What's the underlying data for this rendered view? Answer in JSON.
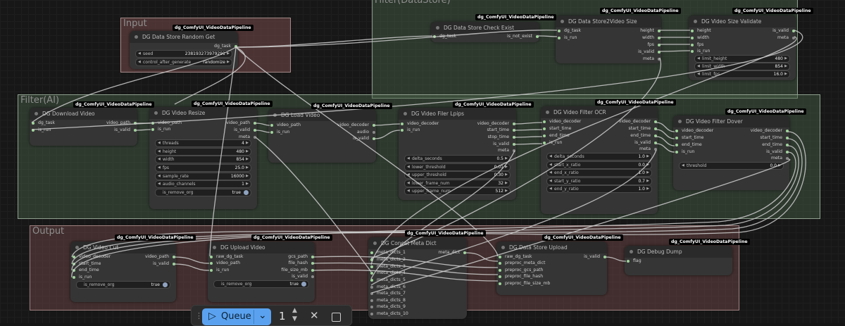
{
  "badge": "dg_ComfyUI_VideoDataPipeline",
  "groups": {
    "input": "Input",
    "ai": "Filter(AI)",
    "ds": "Filter(DataStore)",
    "out": "Output"
  },
  "nodes": {
    "random_get": {
      "title": "DG Data Store Random Get",
      "out_dg_task": "dg_task",
      "w_seed": {
        "label": "seed",
        "value": "238193273979291"
      },
      "w_ctrl": {
        "label": "control_after_generate",
        "value": "randomize"
      }
    },
    "check_exist": {
      "title": "DG Data Store Check Exist",
      "in_dg_task": "dg_task",
      "out_is_not_exist": "is_not_exist"
    },
    "ds2vs": {
      "title": "DG Data Store2Video Size",
      "in": [
        "dg_task",
        "is_run"
      ],
      "out": [
        "height",
        "width",
        "fps",
        "is_valid",
        "meta"
      ]
    },
    "vsv": {
      "title": "DG Video Size Validate",
      "in": [
        "height",
        "width",
        "fps",
        "is_run"
      ],
      "out": [
        "is_valid",
        "meta"
      ],
      "widgets": [
        {
          "label": "limit_height",
          "value": "480"
        },
        {
          "label": "limit_width",
          "value": "854"
        },
        {
          "label": "limit_fps",
          "value": "16.0"
        }
      ]
    },
    "download": {
      "title": "DG Download Video",
      "in": [
        "dg_task",
        "is_run"
      ],
      "out": [
        "video_path",
        "is_valid"
      ]
    },
    "resize": {
      "title": "DG Video Resize",
      "in": [
        "video_path",
        "is_run"
      ],
      "out": [
        "video_path",
        "is_valid",
        "meta"
      ],
      "widgets": [
        {
          "label": "threads",
          "value": "4"
        },
        {
          "label": "height",
          "value": "480"
        },
        {
          "label": "width",
          "value": "854"
        },
        {
          "label": "fps",
          "value": "25.0"
        },
        {
          "label": "sample_rate",
          "value": "16000"
        },
        {
          "label": "audio_channels",
          "value": "1"
        }
      ],
      "toggle": {
        "label": "is_remove_org",
        "value": "true"
      }
    },
    "load": {
      "title": "DG Load Video",
      "in": [
        "video_path",
        "is_run"
      ],
      "out": [
        "video_decoder",
        "audio",
        "is_valid"
      ]
    },
    "lpips": {
      "title": "DG Video Filer Lpips",
      "in": [
        "video_decoder",
        "is_run"
      ],
      "out": [
        "video_decoder",
        "start_time",
        "stop_time",
        "is_valid",
        "meta"
      ],
      "widgets": [
        {
          "label": "delta_seconds",
          "value": "0.5"
        },
        {
          "label": "lower_threshold",
          "value": "0.01"
        },
        {
          "label": "upper_threshold",
          "value": "0.30"
        },
        {
          "label": "lower_frame_num",
          "value": "32"
        },
        {
          "label": "upper_frame_num",
          "value": "512"
        }
      ]
    },
    "ocr": {
      "title": "DG Video Filter OCR",
      "in": [
        "video_decoder",
        "start_time",
        "end_time",
        "is_run"
      ],
      "out": [
        "video_decoder",
        "start_time",
        "end_time",
        "is_valid",
        "meta"
      ],
      "widgets": [
        {
          "label": "delta_seconds",
          "value": "1.0"
        },
        {
          "label": "start_x_ratio",
          "value": "0.0"
        },
        {
          "label": "end_x_ratio",
          "value": "1.0"
        },
        {
          "label": "start_y_ratio",
          "value": "0.7"
        },
        {
          "label": "end_y_ratio",
          "value": "1.0"
        }
      ]
    },
    "dover": {
      "title": "DG Video Filter Dover",
      "in": [
        "video_decoder",
        "start_time",
        "end_time",
        "is_run"
      ],
      "out": [
        "video_decoder",
        "start_time",
        "end_time",
        "is_valid",
        "meta"
      ],
      "widgets": [
        {
          "label": "threshold",
          "value": "0.0"
        }
      ]
    },
    "cut": {
      "title": "DG Video Cut",
      "in": [
        "video_decoder",
        "start_time",
        "end_time",
        "is_run"
      ],
      "out": [
        "video_path",
        "is_valid"
      ],
      "toggle": {
        "label": "is_remove_org",
        "value": "true"
      }
    },
    "upload": {
      "title": "DG Upload Video",
      "in": [
        "raw_dg_task",
        "video_path",
        "is_run"
      ],
      "out": [
        "gcs_path",
        "file_hash",
        "file_size_mb",
        "is_valid"
      ],
      "toggle": {
        "label": "is_remove_org",
        "value": "true"
      }
    },
    "concat": {
      "title": "DG Concat Meta Dict",
      "in": [
        "meta_dicts_1",
        "meta_dicts_2",
        "meta_dicts_3",
        "meta_dicts_4",
        "meta_dicts_5",
        "meta_dicts_6",
        "meta_dicts_7",
        "meta_dicts_8",
        "meta_dicts_9",
        "meta_dicts_10"
      ],
      "out": [
        "meta_dict"
      ]
    },
    "upload_ds": {
      "title": "DG Data Store Upload",
      "in": [
        "raw_dg_task",
        "preproc_meta_dict",
        "preproc_gcs_path",
        "preproc_file_hash",
        "preproc_file_size_mb"
      ],
      "out": [
        "is_valid"
      ]
    },
    "debug": {
      "title": "DG Debug Dump",
      "in": [
        "flag"
      ]
    }
  },
  "queue": {
    "label": "Queue",
    "count": "1",
    "play_icon": "▷",
    "chevron_icon": "⌄",
    "cancel_icon": "✕",
    "stop_icon": "□"
  }
}
